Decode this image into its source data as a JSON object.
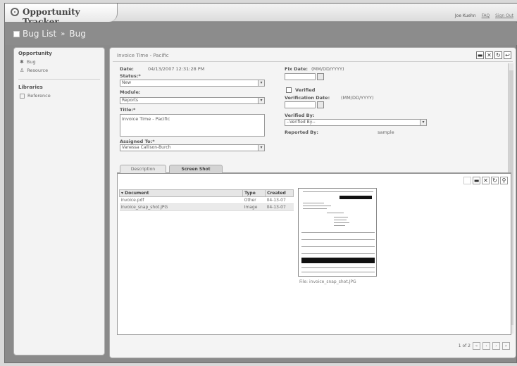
{
  "app": {
    "title": "Opportunity Tracker",
    "user_name": "Joe Kuehn",
    "link_1": "FAQ",
    "link_2": "Sign Out"
  },
  "breadcrumb": {
    "root": "Bug List",
    "separator": "»",
    "current": "Bug"
  },
  "sidebar": {
    "section_1": "Opportunity",
    "items_1": [
      {
        "label": "Bug",
        "icon": "bug-icon"
      },
      {
        "label": "Resource",
        "icon": "person-icon"
      }
    ],
    "section_2": "Libraries",
    "items_2": [
      {
        "label": "Reference",
        "icon": "book-icon"
      }
    ]
  },
  "panel": {
    "title": "Invoice Time - Pacific",
    "buttons": {
      "save": "▬",
      "close": "✕",
      "refresh": "↻",
      "back": "↩"
    }
  },
  "form": {
    "date_label": "Date:",
    "date_value": "04/13/2007 12:31:28 PM",
    "status_label": "Status:*",
    "status_value": "New",
    "module_label": "Module:",
    "module_value": "Reports",
    "title_label": "Title:*",
    "title_value": "Invoice Time - Pacific",
    "assigned_label": "Assigned To:*",
    "assigned_value": "Vanessa Callison-Burch",
    "fix_date_label": "Fix Date:",
    "fix_date_hint": "(MM/DD/YYYY)",
    "verified_label": "Verified",
    "verification_date_label": "Verification Date:",
    "verification_date_hint": "(MM/DD/YYYY)",
    "verified_by_label": "Verified By:",
    "verified_by_value": "--Verified By--",
    "reported_by_label": "Reported By:",
    "reported_by_value": "sample"
  },
  "tabs": [
    {
      "label": "Description",
      "active": false
    },
    {
      "label": "Screen Shot",
      "active": true
    }
  ],
  "documents": {
    "columns": [
      "Document",
      "Type",
      "Created"
    ],
    "rows": [
      {
        "name": "invoice.pdf",
        "type": "Other",
        "created": "04-13-07"
      },
      {
        "name": "invoice_snap_shot.JPG",
        "type": "Image",
        "created": "04-13-07"
      }
    ]
  },
  "preview": {
    "caption": "File: invoice_snap_shot.JPG"
  },
  "pager": {
    "text": "1 of 2"
  }
}
